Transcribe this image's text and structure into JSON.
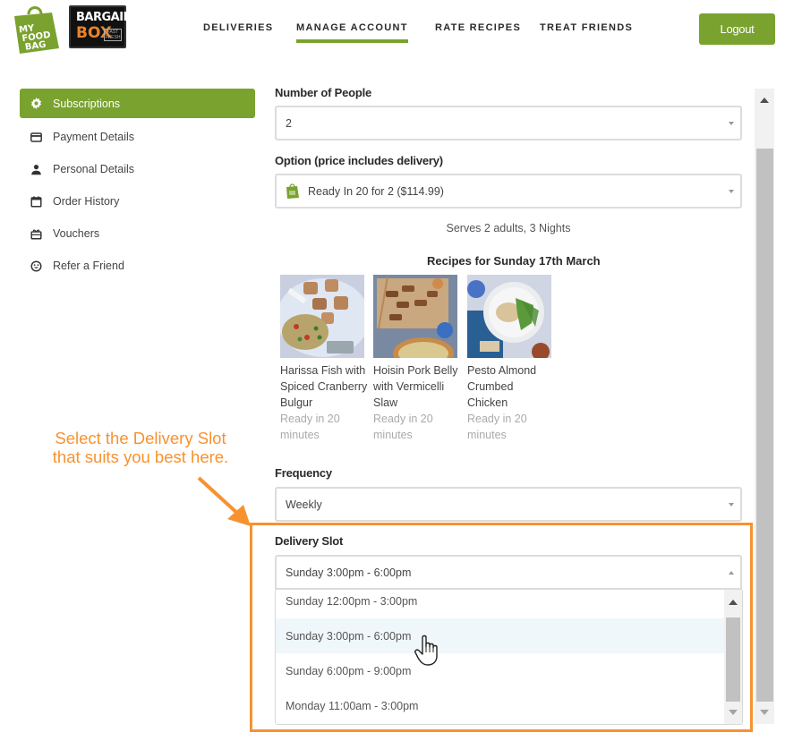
{
  "header": {
    "logo_mfb_lines": [
      "MY",
      "FOOD",
      "BAG"
    ],
    "logo_bb": {
      "line1": "BARGAIN",
      "line2": "BOX",
      "badge": "FAST FRESH"
    },
    "nav": [
      {
        "label": "DELIVERIES",
        "active": false
      },
      {
        "label": "MANAGE ACCOUNT",
        "active": true
      },
      {
        "label": "RATE RECIPES",
        "active": false
      },
      {
        "label": "TREAT FRIENDS",
        "active": false
      }
    ],
    "logout_label": "Logout"
  },
  "sidebar": {
    "items": [
      {
        "label": "Subscriptions",
        "icon": "gear-icon",
        "active": true
      },
      {
        "label": "Payment Details",
        "icon": "credit-card-icon",
        "active": false
      },
      {
        "label": "Personal Details",
        "icon": "person-icon",
        "active": false
      },
      {
        "label": "Order History",
        "icon": "calendar-icon",
        "active": false
      },
      {
        "label": "Vouchers",
        "icon": "gift-icon",
        "active": false
      },
      {
        "label": "Refer a Friend",
        "icon": "smiley-icon",
        "active": false
      }
    ]
  },
  "form": {
    "people": {
      "label": "Number of People",
      "value": "2"
    },
    "option": {
      "label": "Option (price includes delivery)",
      "value": "Ready In 20 for 2 ($114.99)"
    },
    "serves": "Serves 2 adults, 3 Nights",
    "recipes_title": "Recipes for Sunday 17th March",
    "recipes": [
      {
        "name": "Harissa Fish with Spiced Cranberry Bulgur",
        "time": "Ready in 20 minutes"
      },
      {
        "name": "Hoisin Pork Belly with Vermicelli Slaw",
        "time": "Ready in 20 minutes"
      },
      {
        "name": "Pesto Almond Crumbed Chicken",
        "time": "Ready in 20 minutes"
      }
    ],
    "frequency": {
      "label": "Frequency",
      "value": "Weekly"
    },
    "delivery_slot": {
      "label": "Delivery Slot",
      "value": "Sunday 3:00pm - 6:00pm",
      "options": [
        "Sunday 12:00pm - 3:00pm",
        "Sunday 3:00pm - 6:00pm",
        "Sunday 6:00pm - 9:00pm",
        "Monday 11:00am - 3:00pm"
      ],
      "hovered_index": 1
    }
  },
  "annotation": {
    "text_line1": "Select the Delivery Slot",
    "text_line2": "that suits you best here.",
    "color": "#f7922f"
  },
  "colors": {
    "brand_green": "#7aa22f",
    "annotation_orange": "#f7922f"
  }
}
